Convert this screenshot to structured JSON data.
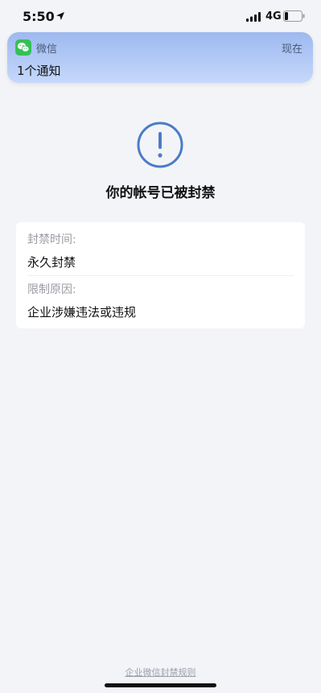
{
  "status_bar": {
    "time": "5:50",
    "network": "4G"
  },
  "notification": {
    "app_name": "微信",
    "time_label": "现在",
    "message": "1个通知"
  },
  "main": {
    "title": "你的帐号已被封禁",
    "alert_color": "#4a7cc7",
    "ban_info": {
      "time_label": "封禁时间:",
      "time_value": "永久封禁",
      "reason_label": "限制原因:",
      "reason_value": "企业涉嫌违法或违规"
    }
  },
  "footer": {
    "rules_link": "企业微信封禁规则"
  },
  "icons": [
    "location-arrow-icon",
    "signal-icon",
    "battery-icon",
    "wechat-icon",
    "exclamation-circle-icon"
  ]
}
